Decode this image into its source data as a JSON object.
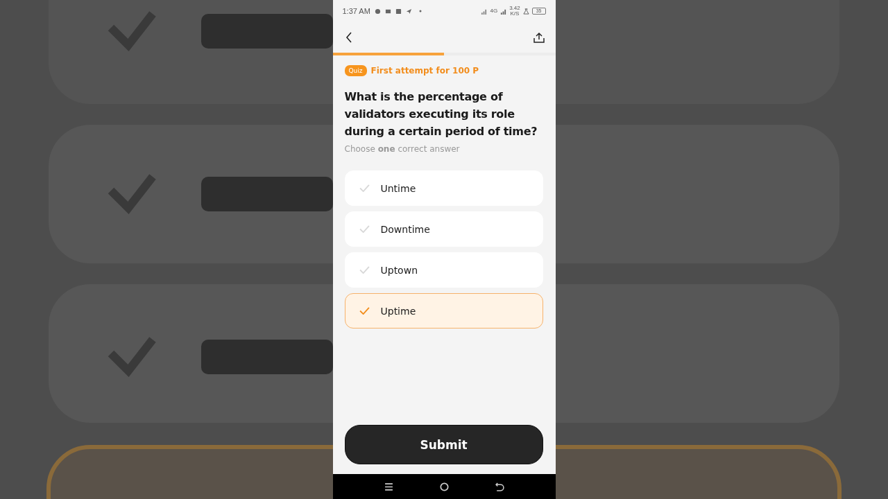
{
  "status_bar": {
    "time": "1:37 AM",
    "network": "4G",
    "speed_value": "3.42",
    "speed_unit": "K/S",
    "battery": "35"
  },
  "progress": {
    "level": 0.5
  },
  "badge": "Quiz",
  "reward": "First attempt for 100 P",
  "question": "What is the percentage of validators executing its role during a certain period of time?",
  "hint": "Choose **one** correct answer",
  "options": [
    {
      "label": "Untime",
      "selected": false
    },
    {
      "label": "Downtime",
      "selected": false
    },
    {
      "label": "Uptown",
      "selected": false
    },
    {
      "label": "Uptime",
      "selected": true
    }
  ],
  "submit": "Submit"
}
